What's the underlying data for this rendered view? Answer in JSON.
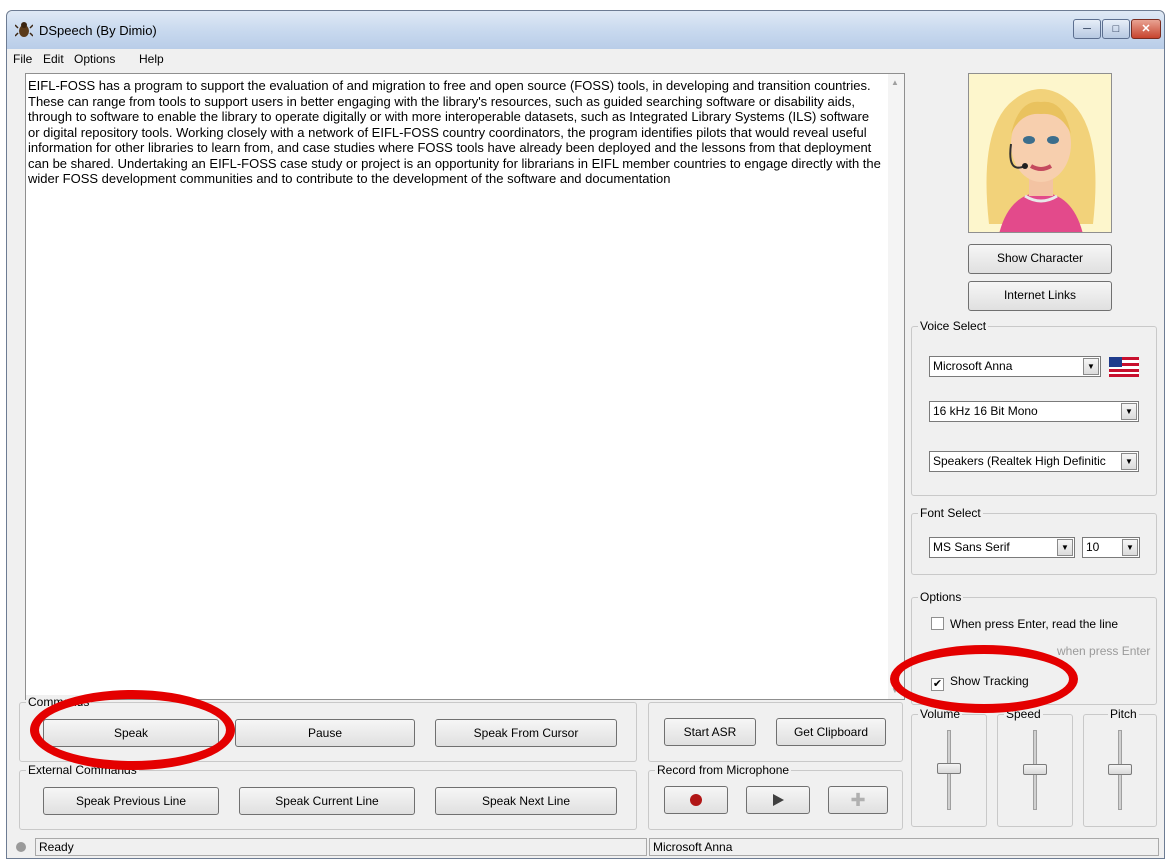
{
  "window": {
    "title": "DSpeech (By Dimio)"
  },
  "menu": [
    "File",
    "Edit",
    "Options",
    "Help"
  ],
  "editor": {
    "text": "EIFL-FOSS has a program to support the evaluation of and migration to free and open source (FOSS) tools, in developing and transition countries. These can range from tools to support users in better engaging with the library's resources, such as guided searching software or disability aids, through to software to enable the library to operate digitally or with more interoperable datasets, such as Integrated Library Systems (ILS) software or digital repository tools. Working closely with a network of EIFL-FOSS country coordinators, the program identifies pilots that would reveal useful information for other libraries to learn from, and case studies where FOSS tools have already been deployed and the lessons from that deployment can be shared. Undertaking an EIFL-FOSS case study or project is an opportunity for librarians in EIFL member countries to engage directly with the wider FOSS development communities and to contribute to the development of the software and documentation"
  },
  "commands": {
    "legend": "Commands",
    "speak": "Speak",
    "pause": "Pause",
    "speak_from_cursor": "Speak From Cursor"
  },
  "asr": {
    "start_asr": "Start ASR",
    "get_clipboard": "Get Clipboard"
  },
  "external": {
    "legend": "External Commands",
    "speak_previous": "Speak Previous Line",
    "speak_current": "Speak Current Line",
    "speak_next": "Speak Next Line"
  },
  "record": {
    "legend": "Record from Microphone"
  },
  "right_panel": {
    "show_character": "Show Character",
    "internet_links": "Internet Links"
  },
  "voice_select": {
    "legend": "Voice Select",
    "voice": "Microsoft Anna",
    "format": "16 kHz 16 Bit Mono",
    "output": "Speakers (Realtek High Definitic"
  },
  "font_select": {
    "legend": "Font Select",
    "font": "MS Sans Serif",
    "size": "10"
  },
  "options": {
    "legend": "Options",
    "read_line": "When press Enter, read the line",
    "hidden_option": "when press Enter",
    "show_tracking": "Show Tracking",
    "read_line_checked": false,
    "show_tracking_checked": true
  },
  "sliders": {
    "volume_legend": "Volume",
    "speed_legend": "Speed",
    "pitch_legend": "Pitch"
  },
  "status": {
    "state": "Ready",
    "voice": "Microsoft Anna"
  },
  "colors": {
    "annotation": "#e40000",
    "record_dot": "#b11616"
  }
}
